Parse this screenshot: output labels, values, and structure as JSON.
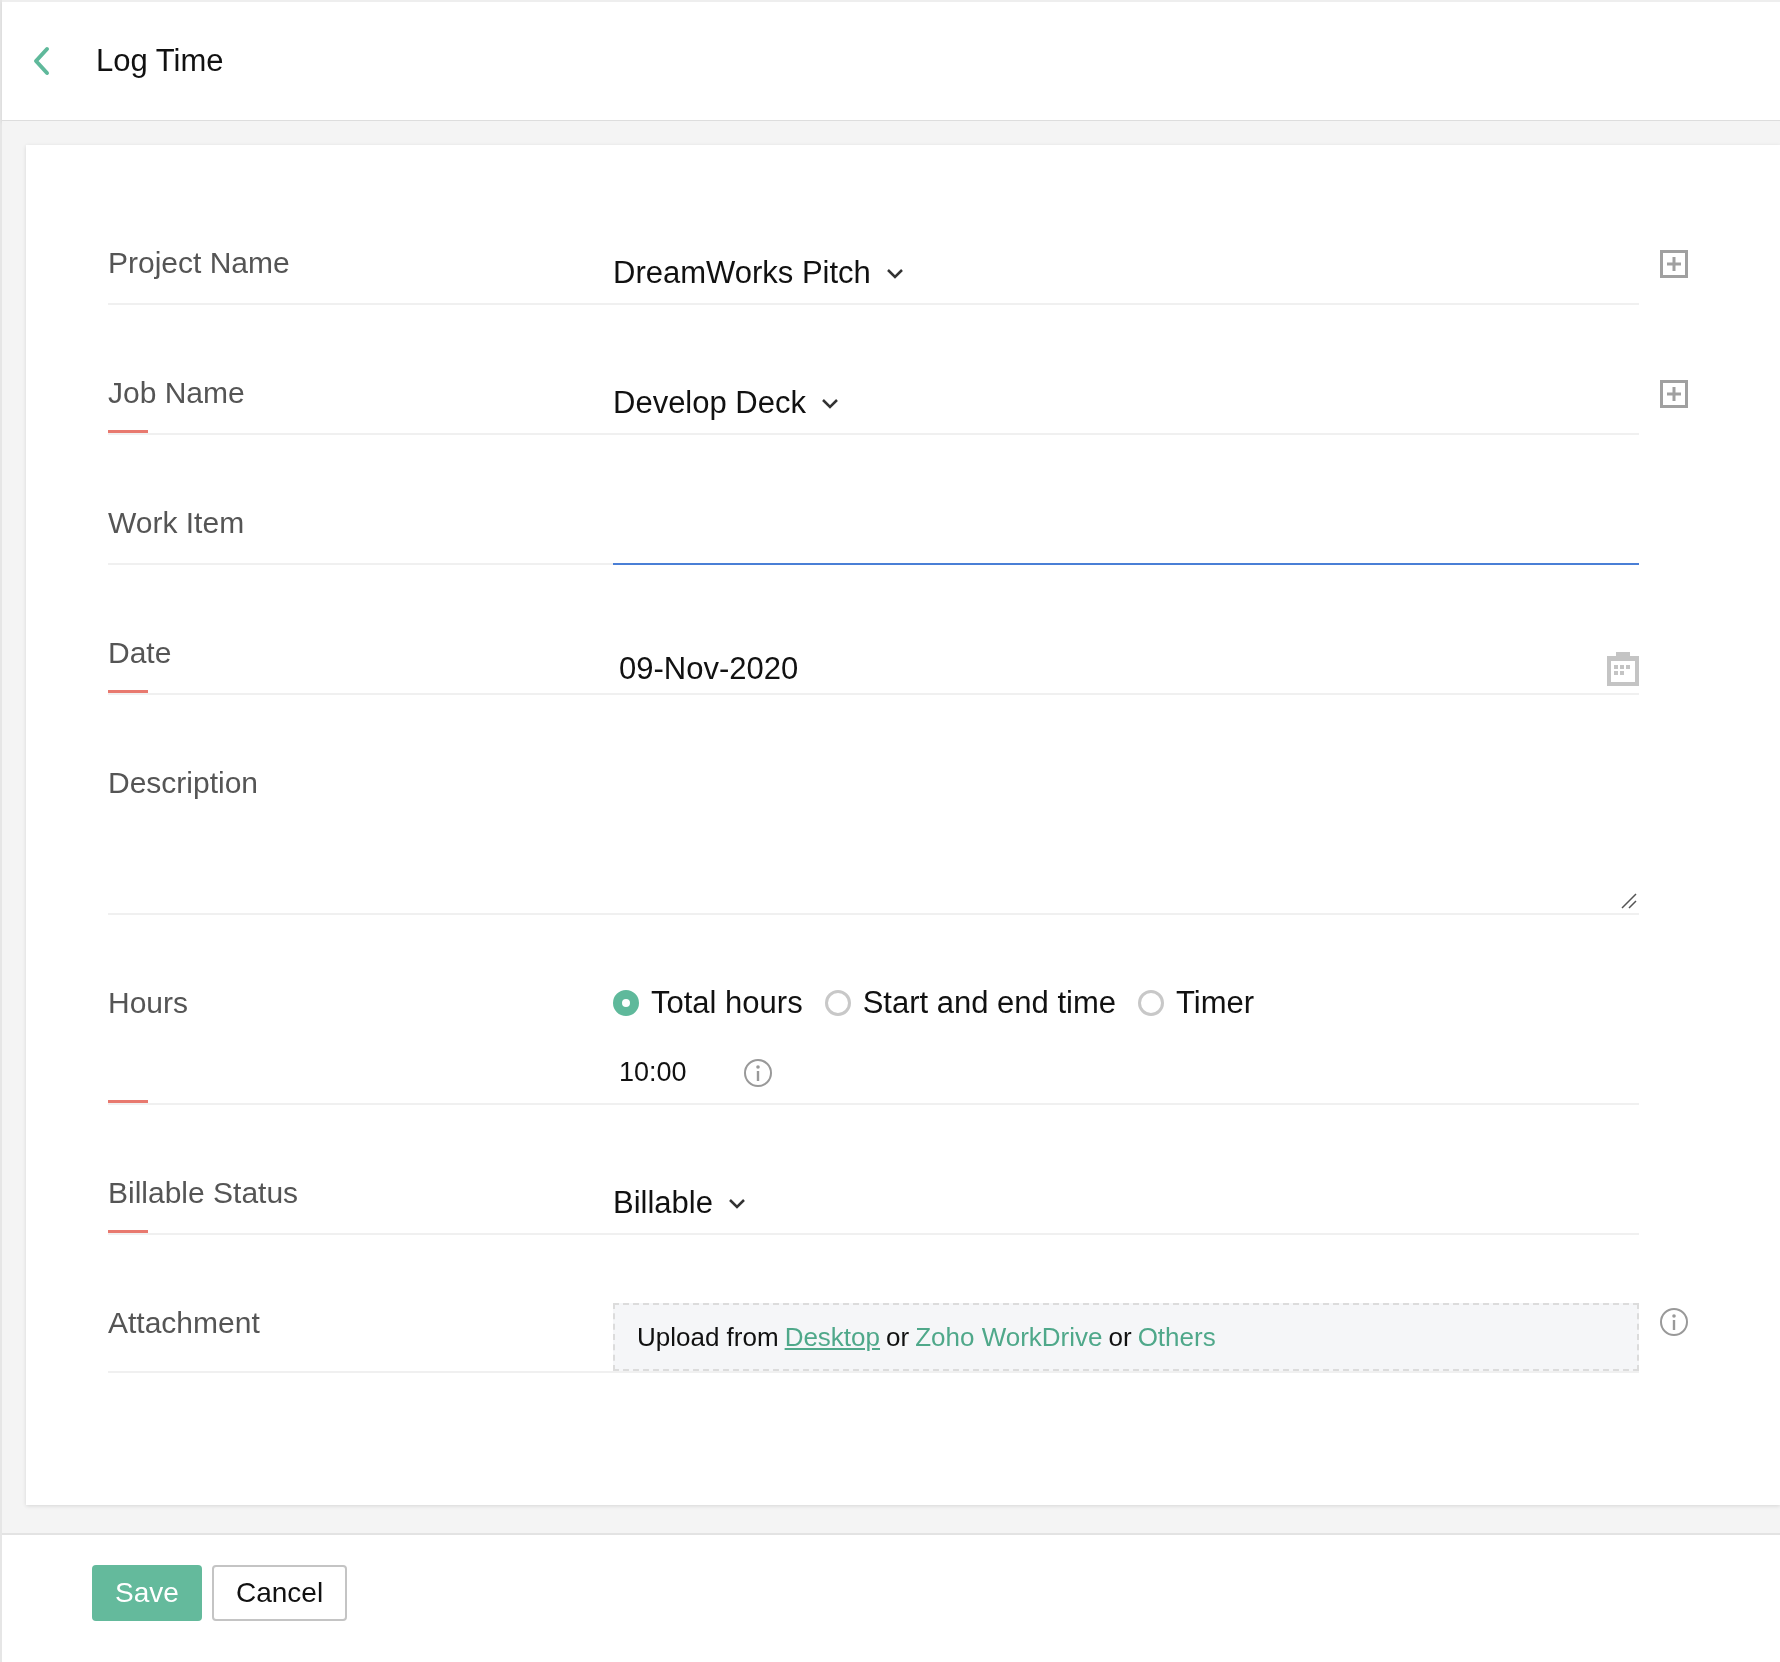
{
  "header": {
    "title": "Log Time"
  },
  "fields": [
    {
      "kind": "select",
      "label": "Project Name",
      "required": false,
      "focused": false,
      "value": "DreamWorks Pitch",
      "add_button": true
    },
    {
      "kind": "select",
      "label": "Job Name",
      "required": true,
      "focused": false,
      "value": "Develop Deck",
      "add_button": true
    },
    {
      "kind": "text",
      "label": "Work Item",
      "required": false,
      "focused": true
    },
    {
      "kind": "date",
      "label": "Date",
      "required": true,
      "focused": false,
      "value": "09-Nov-2020"
    },
    {
      "kind": "textarea",
      "label": "Description",
      "required": false,
      "focused": false
    },
    {
      "kind": "hours",
      "label": "Hours",
      "required": true,
      "focused": false,
      "options": [
        {
          "label": "Total hours",
          "selected": true
        },
        {
          "label": "Start and end time",
          "selected": false
        },
        {
          "label": "Timer",
          "selected": false
        }
      ],
      "value": "10:00"
    },
    {
      "kind": "select",
      "label": "Billable Status",
      "required": true,
      "focused": false,
      "value": "Billable",
      "add_button": false
    },
    {
      "kind": "attachment",
      "label": "Attachment",
      "required": false,
      "focused": false,
      "parts": [
        {
          "kind": "plain",
          "text": "Upload from"
        },
        {
          "kind": "link",
          "text": "Desktop",
          "underlined": true
        },
        {
          "kind": "plain",
          "text": "or"
        },
        {
          "kind": "link",
          "text": "Zoho WorkDrive",
          "underlined": false
        },
        {
          "kind": "plain",
          "text": "or"
        },
        {
          "kind": "link",
          "text": "Others",
          "underlined": false
        }
      ]
    }
  ],
  "buttons": [
    {
      "kind": "primary",
      "label": "Save"
    },
    {
      "kind": "secondary",
      "label": "Cancel"
    }
  ]
}
